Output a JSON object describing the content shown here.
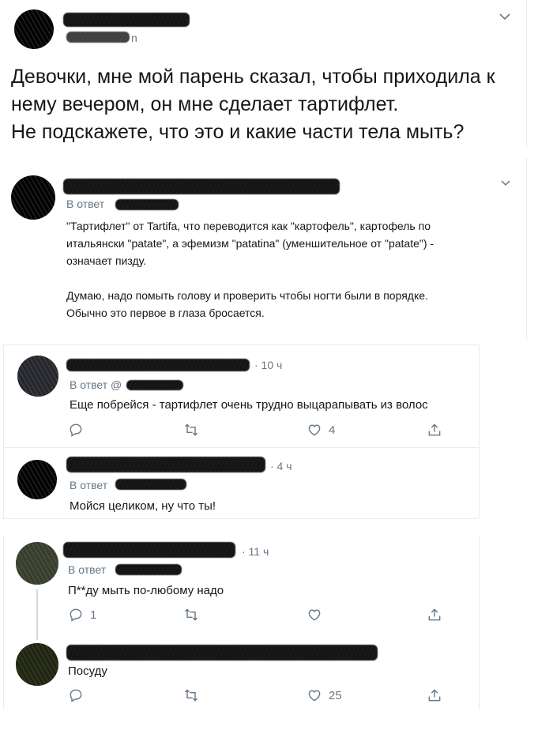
{
  "main_tweet": {
    "text_lines": [
      "Девочки, мне мой парень сказал, чтобы приходила к",
      "нему вечером, он мне сделает тартифлет.",
      "Не подскажете, что это и какие части тела мыть?"
    ]
  },
  "reply1": {
    "reply_prefix": "В ответ",
    "paragraph1": [
      "\"Тартифлет\"  от Tartifa, что переводится как \"картофель\", картофель по",
      "итальянски \"patate\",  а эфемизм \"patatina\" (уменшительное от \"patate\") -",
      "означает пизду."
    ],
    "paragraph2": [
      "Думаю, надо помыть голову и проверить чтобы ногти были в порядке.",
      "Обычно это первое в глаза бросается."
    ]
  },
  "reply2": {
    "time": "· 10 ч",
    "reply_prefix": "В ответ @",
    "text": "Еще побрейся - тартифлет очень трудно выцарапывать из волос",
    "likes": "4"
  },
  "reply3": {
    "time": "· 4 ч",
    "reply_prefix": "В ответ",
    "text": "Мойся целиком, ну что ты!"
  },
  "reply4": {
    "time": "· 11 ч",
    "reply_prefix": "В ответ",
    "text": "П**ду мыть по-любому надо",
    "replies": "1"
  },
  "reply5": {
    "text": "Посуду",
    "likes": "25"
  },
  "icons": [
    "chevron-down-icon",
    "reply-icon",
    "retweet-icon",
    "like-icon",
    "share-icon"
  ],
  "colors": {
    "muted": "#657786",
    "text": "#14171a",
    "divider": "#e6ecf0"
  }
}
